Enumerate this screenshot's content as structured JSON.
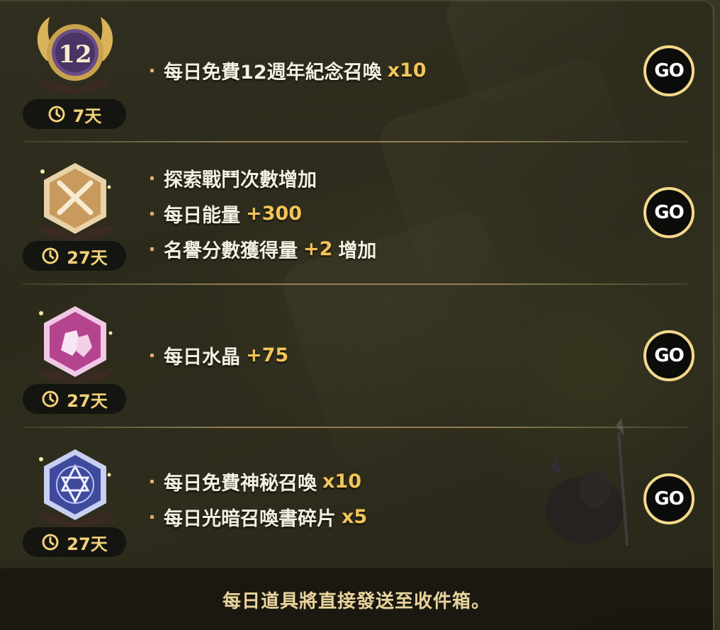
{
  "rewards": [
    {
      "badge": "anniversary-12-badge",
      "badge_text": "12",
      "days": "7天",
      "lines": [
        {
          "text": "每日免費12週年紀念召喚",
          "highlight": "x10"
        }
      ],
      "go_label": "GO"
    },
    {
      "badge": "crossed-swords-badge",
      "days": "27天",
      "lines": [
        {
          "text": "探索戰鬥次數增加",
          "highlight": ""
        },
        {
          "text": "每日能量",
          "highlight": "+300"
        },
        {
          "text": "名譽分數獲得量",
          "highlight": "+2",
          "suffix": "增加"
        }
      ],
      "go_label": "GO"
    },
    {
      "badge": "crystal-badge",
      "days": "27天",
      "lines": [
        {
          "text": "每日水晶",
          "highlight": "+75"
        }
      ],
      "go_label": "GO"
    },
    {
      "badge": "mystic-star-badge",
      "days": "27天",
      "lines": [
        {
          "text": "每日免費神秘召喚",
          "highlight": "x10"
        },
        {
          "text": "每日光暗召喚書碎片",
          "highlight": "x5"
        }
      ],
      "go_label": "GO"
    }
  ],
  "footer": {
    "note": "每日道具將直接發送至收件箱。"
  },
  "colors": {
    "highlight": "#f3c45a",
    "timer_text": "#f2d27a",
    "go_border": "#f4d88a",
    "bullet": "#e9a46a"
  }
}
